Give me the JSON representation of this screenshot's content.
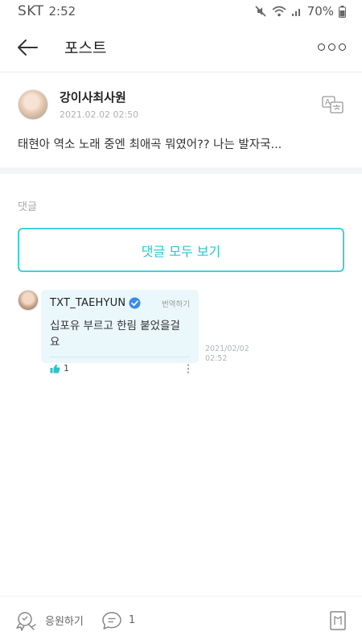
{
  "status_bar": {
    "carrier": "SKT",
    "time": "2:52",
    "battery": "70%",
    "icons": [
      "mute-icon",
      "wifi-icon",
      "signal-icon",
      "battery-icon"
    ]
  },
  "header": {
    "title": "포스트",
    "back_icon": "back-arrow-icon",
    "more_icon": "more-icon"
  },
  "post": {
    "author": "강이사최사원",
    "date": "2021.02.02 02:50",
    "text": "태현아 역소 노래 중엔 최애곡 뭐였어?? 나는 발자국..."
  },
  "comments_section": {
    "label": "댓글",
    "view_all": "댓글 모두 보기"
  },
  "comment": {
    "author": "TXT_TAEHYUN",
    "translate": "번역하기",
    "text": "십포유 부르고 한림 붙었을걸요",
    "likes": "1",
    "time_line1": "2021/02/02",
    "time_line2": "02:52"
  },
  "bottom_bar": {
    "cheer": "응원하기",
    "comment_count": "1"
  },
  "colors": {
    "accent": "#28c6cd",
    "bubble": "#eaf7fb",
    "verified": "#3c8be6"
  }
}
